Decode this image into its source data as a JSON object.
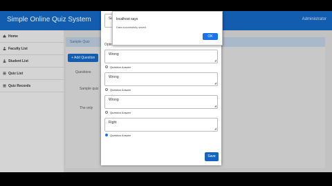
{
  "app": {
    "title": "Simple Online Quiz System",
    "admin_label": "Administrator"
  },
  "sidebar": {
    "items": [
      {
        "label": "Home",
        "icon": "home-icon"
      },
      {
        "label": "Faculty List",
        "icon": "users-icon"
      },
      {
        "label": "Student List",
        "icon": "users-icon"
      },
      {
        "label": "Quiz List",
        "icon": "list-icon"
      },
      {
        "label": "Quiz Records",
        "icon": "list-icon"
      }
    ]
  },
  "main": {
    "card_title": "Sample Quiz",
    "add_button": "+ Add Question",
    "col_questions": "Questions",
    "row1": "Sample quiz",
    "row2": "The only"
  },
  "modal": {
    "question_input": "Sa",
    "options_label": "Options:",
    "options": [
      {
        "value": "Wrong",
        "radio_label": "Question Answer",
        "checked": false
      },
      {
        "value": "Wrong",
        "radio_label": "Question Answer",
        "checked": false
      },
      {
        "value": "Wrong",
        "radio_label": "Question Answer",
        "checked": false
      },
      {
        "value": "Right",
        "radio_label": "Question Answer",
        "checked": true
      }
    ],
    "save": "Save"
  },
  "alert": {
    "title": "localhost says",
    "message": "Data successfully saved.",
    "ok": "OK"
  },
  "colors": {
    "primary": "#1565c0",
    "accent": "#1a73e8"
  }
}
